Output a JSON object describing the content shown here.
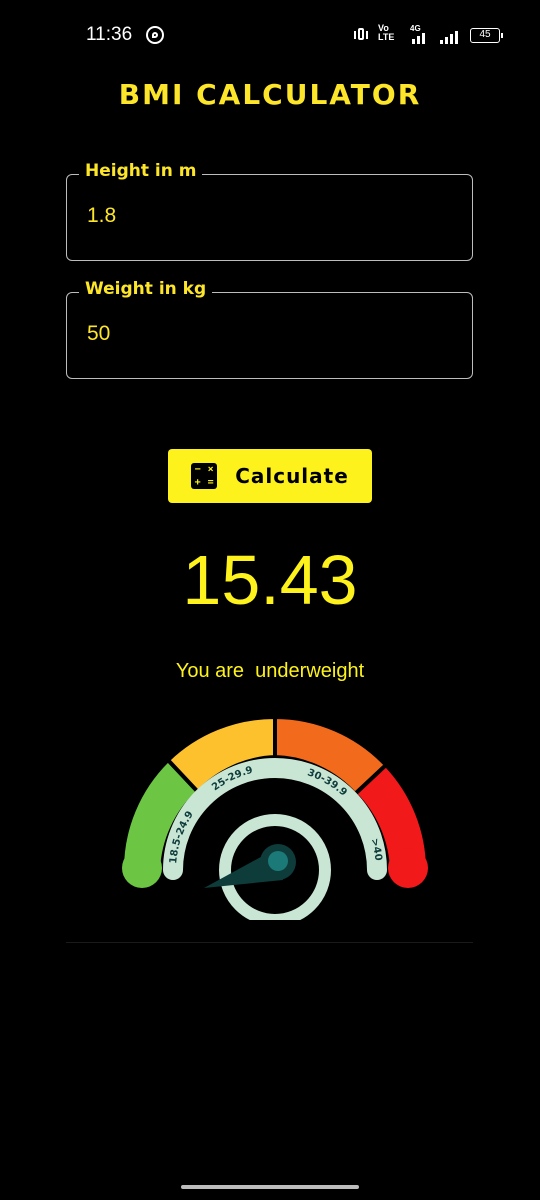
{
  "status_bar": {
    "time": "11:36",
    "volte_top": "Vo",
    "volte_bottom": "LTE",
    "network": "4G",
    "battery": "45"
  },
  "app": {
    "title": "BMI CALCULATOR"
  },
  "height_field": {
    "label": "Height in m",
    "value": "1.8"
  },
  "weight_field": {
    "label": "Weight in kg",
    "value": "50"
  },
  "calculate_button": {
    "label": "Calculate",
    "icon": "calculator-icon"
  },
  "result": {
    "bmi": "15.43",
    "message": "You are  underweight"
  },
  "gauge": {
    "ranges": [
      "18.5-24.9",
      "25-29.9",
      "30-39.9",
      ">40"
    ],
    "colors": {
      "green": "#6cc644",
      "yellow": "#fdc12e",
      "orange": "#f26a1b",
      "red": "#f2191b",
      "band": "#c9e6d5",
      "needle": "#0e3c3b"
    }
  },
  "colors": {
    "accent": "#fde52a",
    "button": "#fdf21c",
    "background": "#000000"
  }
}
